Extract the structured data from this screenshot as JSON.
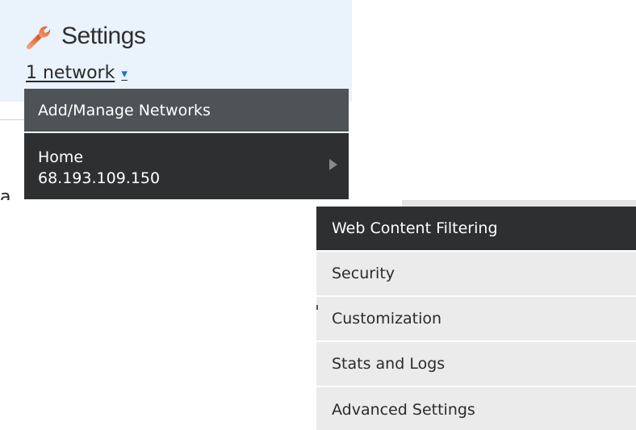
{
  "header": {
    "title": "Settings",
    "icon": "wrench-icon",
    "network_selector": "1 network",
    "caret": "▾"
  },
  "network_menu": {
    "manage_label": "Add/Manage Networks",
    "home": {
      "name": "Home",
      "ip": "68.193.109.150"
    }
  },
  "side_menu": {
    "items": [
      {
        "label": "Web Content Filtering",
        "active": true
      },
      {
        "label": "Security",
        "active": false
      },
      {
        "label": "Customization",
        "active": false
      },
      {
        "label": "Stats and Logs",
        "active": false
      },
      {
        "label": "Advanced Settings",
        "active": false
      }
    ]
  },
  "colors": {
    "header_bg": "#eaf2fb",
    "menu_dark": "#2e2f31",
    "menu_mid": "#4d5357",
    "menu_light": "#ebebeb",
    "link_accent": "#1f6fd0",
    "wrench": "#e8773c"
  }
}
